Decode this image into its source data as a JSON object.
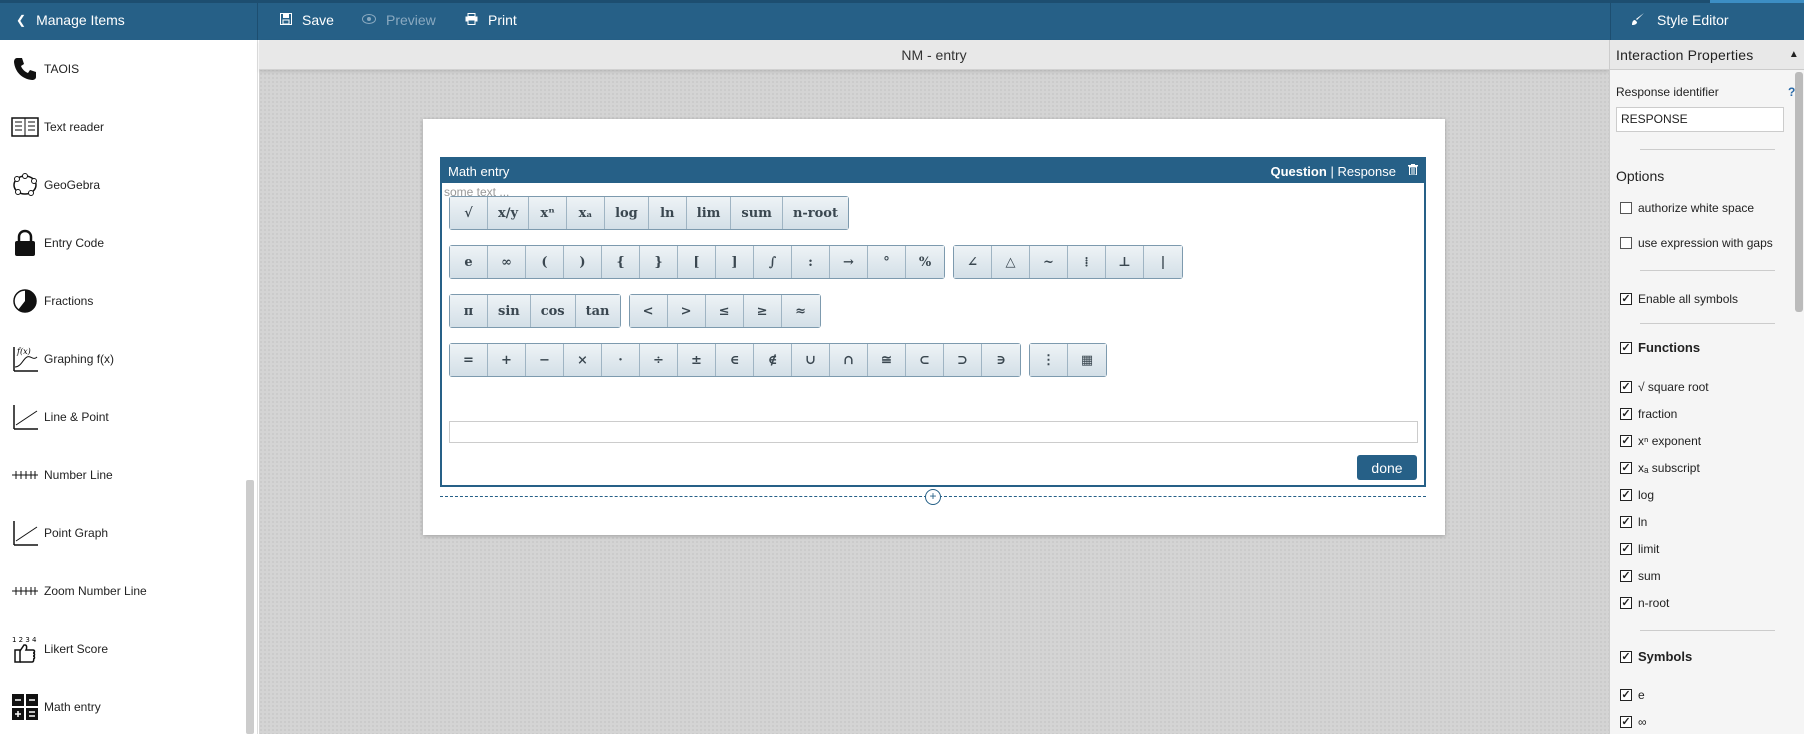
{
  "topbar": {
    "manage_label": "Manage Items",
    "save_label": "Save",
    "preview_label": "Preview",
    "print_label": "Print",
    "style_editor_label": "Style Editor"
  },
  "sidebar": {
    "items": [
      {
        "label": "TAOIS",
        "icon": "phone-icon"
      },
      {
        "label": "Text reader",
        "icon": "text-reader-icon"
      },
      {
        "label": "GeoGebra",
        "icon": "geogebra-icon"
      },
      {
        "label": "Entry Code",
        "icon": "lock-icon"
      },
      {
        "label": "Fractions",
        "icon": "pie-icon"
      },
      {
        "label": "Graphing f(x)",
        "icon": "graph-fx-icon"
      },
      {
        "label": "Line & Point",
        "icon": "line-point-icon"
      },
      {
        "label": "Number Line",
        "icon": "number-line-icon"
      },
      {
        "label": "Point Graph",
        "icon": "point-graph-icon"
      },
      {
        "label": "Zoom Number Line",
        "icon": "zoom-number-line-icon"
      },
      {
        "label": "Likert Score",
        "icon": "thumb-icon"
      },
      {
        "label": "Math entry",
        "icon": "calculator-icon"
      }
    ]
  },
  "canvas": {
    "title": "NM - entry",
    "widget": {
      "title": "Math entry",
      "question_label": "Question",
      "separator": "|",
      "response_label": "Response",
      "prompt": "some text ...",
      "done_label": "done",
      "keyboard": [
        [
          [
            "√",
            "x/y",
            "xⁿ",
            "xₐ",
            "log",
            "ln",
            "lim",
            "sum",
            "n-root"
          ]
        ],
        [
          [
            "e",
            "∞",
            "(",
            ")",
            "{",
            "}",
            "[",
            "]",
            "∫",
            ":",
            "→",
            "°",
            "%"
          ],
          [
            "∠",
            "△",
            "~",
            "⁞",
            "⊥",
            "|"
          ]
        ],
        [
          [
            "π",
            "sin",
            "cos",
            "tan"
          ],
          [
            "<",
            ">",
            "≤",
            "≥",
            "≈"
          ]
        ],
        [
          [
            "=",
            "+",
            "−",
            "×",
            "·",
            "÷",
            "±",
            "∈",
            "∉",
            "∪",
            "∩",
            "≅",
            "⊂",
            "⊃",
            "∋"
          ],
          [
            "⋮",
            "▦"
          ]
        ]
      ]
    }
  },
  "rpanel": {
    "header": "Interaction Properties",
    "response_identifier_label": "Response identifier",
    "help": "?",
    "response_identifier_value": "RESPONSE",
    "options_label": "Options",
    "option_white_space": "authorize white space",
    "option_gaps": "use expression with gaps",
    "enable_all": "Enable all symbols",
    "functions_label": "Functions",
    "functions": [
      "√  square root",
      "fraction",
      "xⁿ exponent",
      "xₐ subscript",
      "log",
      "ln",
      "limit",
      "sum",
      "n-root"
    ],
    "symbols_label": "Symbols",
    "symbols": [
      "e",
      "∞"
    ]
  }
}
